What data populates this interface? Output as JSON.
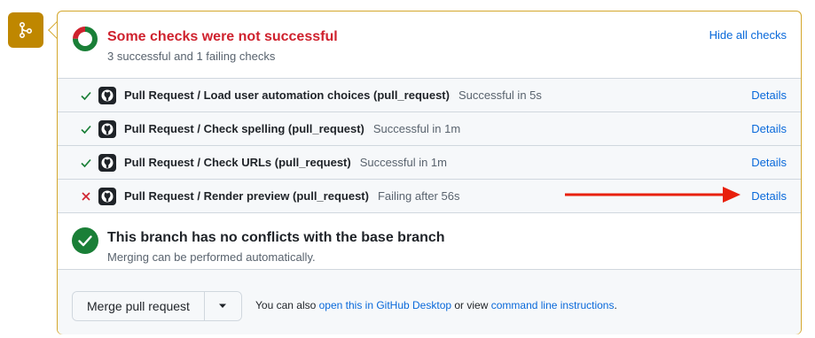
{
  "colors": {
    "attention": "#bf8700",
    "danger": "#cf222e",
    "success": "#1a7f37",
    "link": "#0969da",
    "annotation_arrow": "#e8200c"
  },
  "summary": {
    "title": "Some checks were not successful",
    "subtitle": "3 successful and 1 failing checks",
    "hide_label": "Hide all checks",
    "icon": "checks-donut-icon"
  },
  "checks": [
    {
      "state": "success",
      "name": "Pull Request / Load user automation choices (pull_request)",
      "status": "Successful in 5s",
      "details": "Details"
    },
    {
      "state": "success",
      "name": "Pull Request / Check spelling (pull_request)",
      "status": "Successful in 1m",
      "details": "Details"
    },
    {
      "state": "success",
      "name": "Pull Request / Check URLs (pull_request)",
      "status": "Successful in 1m",
      "details": "Details"
    },
    {
      "state": "failure",
      "name": "Pull Request / Render preview (pull_request)",
      "status": "Failing after 56s",
      "details": "Details"
    }
  ],
  "merge_status": {
    "title": "This branch has no conflicts with the base branch",
    "subtitle": "Merging can be performed automatically."
  },
  "footer": {
    "merge_button": "Merge pull request",
    "text_before": "You can also ",
    "desktop_link": "open this in GitHub Desktop",
    "text_middle": " or view ",
    "cli_link": "command line instructions",
    "text_after": "."
  }
}
